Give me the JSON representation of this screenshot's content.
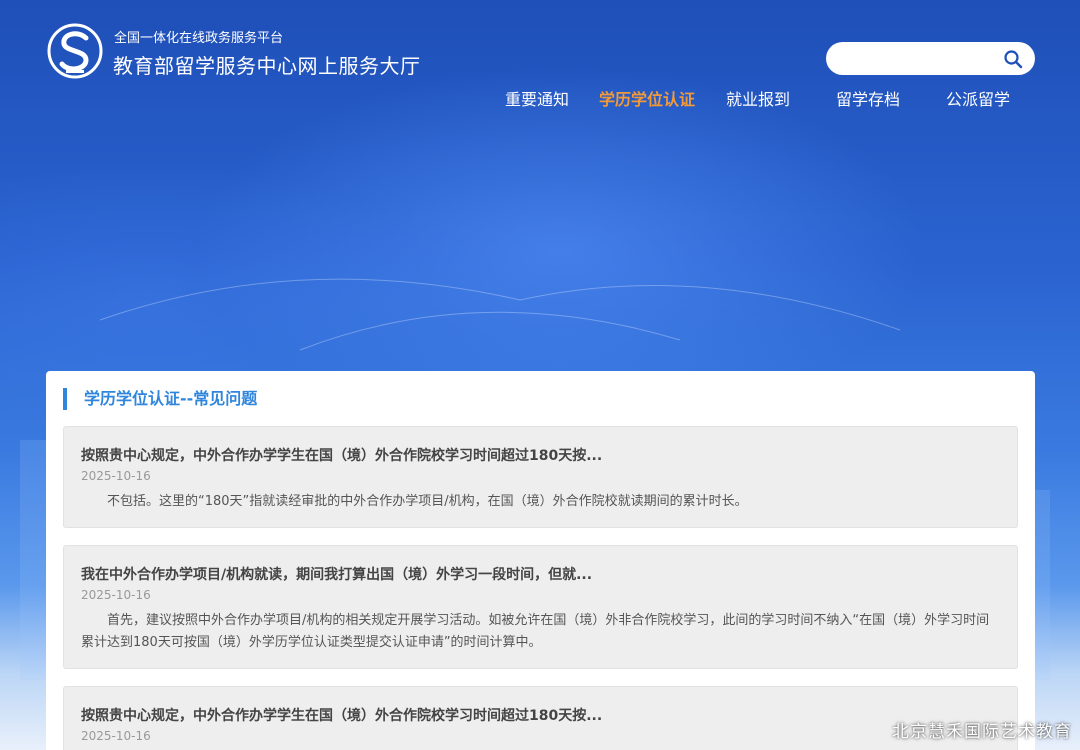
{
  "header": {
    "platform_label": "全国一体化在线政务服务平台",
    "site_title": "教育部留学服务中心网上服务大厅",
    "search_placeholder": ""
  },
  "nav": {
    "items": [
      {
        "label": "重要通知",
        "active": false
      },
      {
        "label": "学历学位认证",
        "active": true
      },
      {
        "label": "就业报到",
        "active": false
      },
      {
        "label": "留学存档",
        "active": false
      },
      {
        "label": "公派留学",
        "active": false
      }
    ]
  },
  "content": {
    "section_title": "学历学位认证--常见问题",
    "faqs": [
      {
        "question": "按照贵中心规定，中外合作办学学生在国（境）外合作院校学习时间超过180天按...",
        "date": "2025-10-16",
        "answer": "不包括。这里的“180天”指就读经审批的中外合作办学项目/机构，在国（境）外合作院校就读期间的累计时长。"
      },
      {
        "question": "我在中外合作办学项目/机构就读，期间我打算出国（境）外学习一段时间，但就...",
        "date": "2025-10-16",
        "answer": "首先，建议按照中外合作办学项目/机构的相关规定开展学习活动。如被允许在国（境）外非合作院校学习，此间的学习时间不纳入“在国（境）外学习时间累计达到180天可按国（境）外学历学位认证类型提交认证申请”的时间计算中。"
      },
      {
        "question": "按照贵中心规定，中外合作办学学生在国（境）外合作院校学习时间超过180天按...",
        "date": "2025-10-16",
        "answer": ""
      }
    ]
  },
  "watermark": "北京慧禾国际艺术教育",
  "colors": {
    "accent": "#2f86dc",
    "nav_active": "#f29a38",
    "hero_blue": "#2a63d0"
  }
}
